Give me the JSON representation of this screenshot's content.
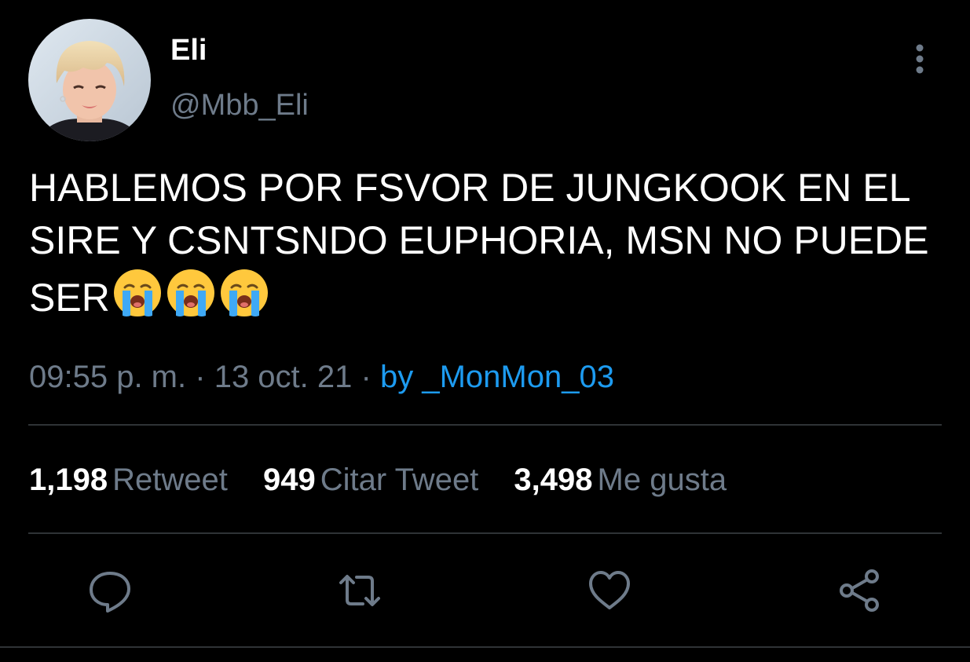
{
  "author": {
    "display_name": "Eli",
    "handle": "@Mbb_Eli"
  },
  "tweet": {
    "text": "HABLEMOS POR FSVOR DE JUNGKOOK EN EL SIRE Y CSNTSNDO EUPHORIA, MSN NO PUEDE SER",
    "emojis": [
      "loudly-crying-face",
      "loudly-crying-face",
      "loudly-crying-face"
    ],
    "time": "09:55 p. m.",
    "separator": "·",
    "date": "13 oct. 21",
    "source": "by _MonMon_03"
  },
  "stats": {
    "retweets_count": "1,198",
    "retweets_label": "Retweet",
    "quotes_count": "949",
    "quotes_label": "Citar Tweet",
    "likes_count": "3,498",
    "likes_label": "Me gusta"
  },
  "actions": {
    "reply_icon": "speech-bubble-icon",
    "retweet_icon": "retweet-arrows-icon",
    "like_icon": "heart-icon",
    "share_icon": "share-nodes-icon",
    "more_icon": "vertical-ellipsis-icon"
  },
  "colors": {
    "background": "#000000",
    "primary_text": "#ffffff",
    "secondary_text": "#6e7b8a",
    "link": "#1d9bf0",
    "divider": "#2f3336"
  }
}
